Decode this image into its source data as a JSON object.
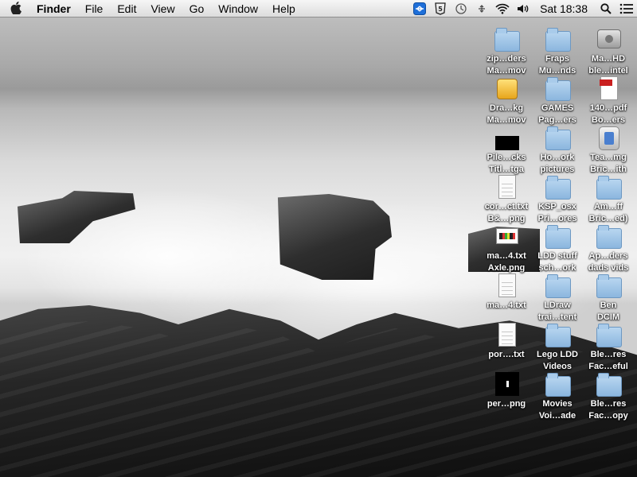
{
  "menubar": {
    "app_name": "Finder",
    "menus": [
      "File",
      "Edit",
      "View",
      "Go",
      "Window",
      "Help"
    ],
    "extras": [
      "teamviewer-icon",
      "html5-icon",
      "time-machine-icon",
      "bluetooth-icon",
      "wifi-icon",
      "volume-icon"
    ],
    "clock": "Sat 18:38"
  },
  "desktop": {
    "icons": [
      {
        "kind": "folder",
        "l1": "zip…ders",
        "l2": "Ma…mov"
      },
      {
        "kind": "folder",
        "l1": "Fraps",
        "l2": "Mu…nds"
      },
      {
        "kind": "drive",
        "l1": "Ma…HD",
        "l2": "ble…intel"
      },
      {
        "kind": "pkg",
        "l1": "Dra…kg",
        "l2": "Ma…mov"
      },
      {
        "kind": "folder",
        "l1": "GAMES",
        "l2": "Pag…ers"
      },
      {
        "kind": "pdf",
        "l1": "140…pdf",
        "l2": "Bo…ers"
      },
      {
        "kind": "black",
        "l1": "Pile…cks",
        "l2": "Titl…tga"
      },
      {
        "kind": "folder",
        "l1": "Ho…ork",
        "l2": "pictures"
      },
      {
        "kind": "app",
        "l1": "Tea…mg",
        "l2": "Bric…ith"
      },
      {
        "kind": "doc",
        "l1": "cor…ct.txt",
        "l2": "B&…png"
      },
      {
        "kind": "folder",
        "l1": "KSP_osx",
        "l2": "Pri…ores"
      },
      {
        "kind": "folder",
        "l1": "Am…ff",
        "l2": "Bric…ed)"
      },
      {
        "kind": "thumb",
        "l1": "ma…4.txt",
        "l2": "Axle.png"
      },
      {
        "kind": "folder",
        "l1": "LDD stuff",
        "l2": "sch…ork"
      },
      {
        "kind": "folder",
        "l1": "Ap…ders",
        "l2": "dads vids"
      },
      {
        "kind": "doc",
        "l1": "ma…4.txt",
        "l2": ""
      },
      {
        "kind": "folder",
        "l1": "LDraw",
        "l2": "trai…tent"
      },
      {
        "kind": "folder",
        "l1": "Ben",
        "l2": "DCIM"
      },
      {
        "kind": "doc",
        "l1": "por….txt",
        "l2": ""
      },
      {
        "kind": "folder",
        "l1": "Lego LDD",
        "l2": "Videos"
      },
      {
        "kind": "folder",
        "l1": "Ble…res",
        "l2": "Fac…eful"
      },
      {
        "kind": "blackbox",
        "l1": "per…png",
        "l2": ""
      },
      {
        "kind": "folder",
        "l1": "Movies",
        "l2": "Voi…ade"
      },
      {
        "kind": "folder",
        "l1": "Ble…res",
        "l2": "Fac…opy"
      }
    ]
  }
}
